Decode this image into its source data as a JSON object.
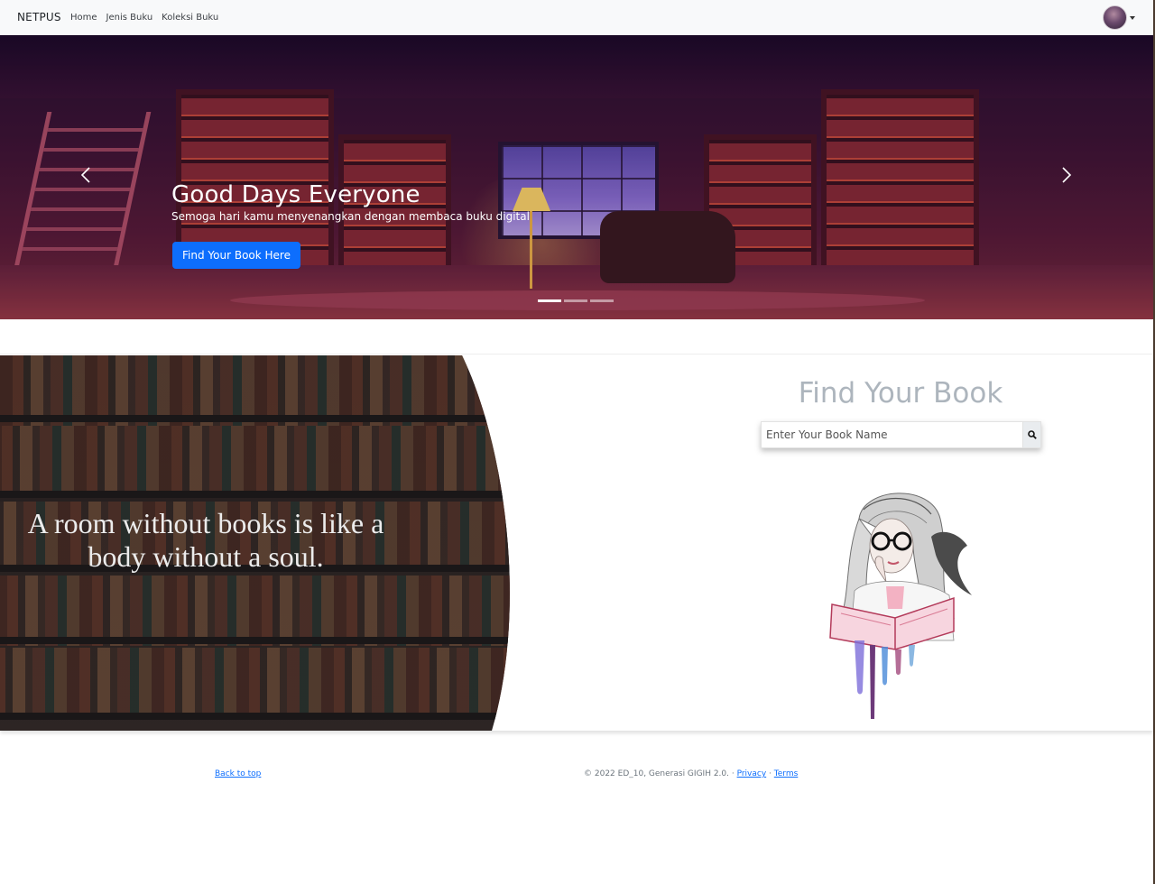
{
  "navbar": {
    "brand": "NETPUS",
    "links": [
      "Home",
      "Jenis Buku",
      "Koleksi Buku"
    ]
  },
  "hero": {
    "title": "Good Days Everyone",
    "subtitle": "Semoga hari kamu menyenangkan dengan membaca buku digital",
    "button": "Find Your Book Here",
    "slides_count": 3,
    "active_slide": 1
  },
  "feature": {
    "quote": "A room without books is like a body without a soul.",
    "find_title": "Find Your Book",
    "search_placeholder": "Enter Your Book Name"
  },
  "footer": {
    "back_to_top": "Back to top",
    "copyright": "© 2022 ED_10, Generasi GIGIH 2.0. · ",
    "privacy": "Privacy",
    "separator": " · ",
    "terms": "Terms"
  },
  "colors": {
    "primary": "#0d6efd",
    "navbar_bg": "#f8f9fa",
    "find_title": "#adb5bd"
  }
}
